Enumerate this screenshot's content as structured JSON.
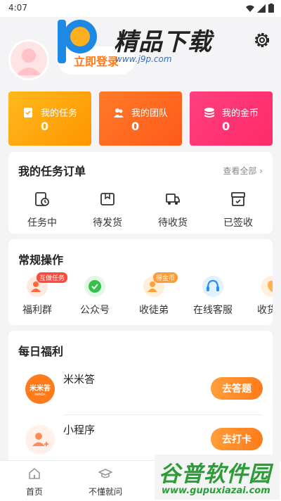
{
  "status_bar": {
    "time": "4:07"
  },
  "header": {
    "login_label": "立即登录",
    "watermark_title": "精品下载",
    "watermark_url": "www.j9p.com"
  },
  "stats": [
    {
      "label": "我的任务",
      "value": "0",
      "icon": "task-icon"
    },
    {
      "label": "我的团队",
      "value": "0",
      "icon": "team-icon"
    },
    {
      "label": "我的金币",
      "value": "0",
      "icon": "coin-icon"
    }
  ],
  "orders": {
    "title": "我的任务订单",
    "view_all": "查看全部 ›",
    "items": [
      {
        "label": "任务中",
        "icon": "clock-doc-icon"
      },
      {
        "label": "待发货",
        "icon": "package-icon"
      },
      {
        "label": "待收货",
        "icon": "truck-icon"
      },
      {
        "label": "已签收",
        "icon": "signed-box-icon"
      }
    ]
  },
  "operations": {
    "title": "常规操作",
    "items": [
      {
        "label": "福利群",
        "badge": "互做任务",
        "icon": "group-icon"
      },
      {
        "label": "公众号",
        "badge": "",
        "icon": "verified-icon"
      },
      {
        "label": "收徒弟",
        "badge": "得金币",
        "icon": "apprentice-icon"
      },
      {
        "label": "在线客服",
        "badge": "",
        "icon": "headset-icon"
      },
      {
        "label": "收货地",
        "badge": "",
        "icon": "address-icon"
      }
    ]
  },
  "welfare": {
    "title": "每日福利",
    "items": [
      {
        "name": "米米答",
        "button": "去答题",
        "logo_text": "米米答",
        "logo_sub": "MIMIDA"
      },
      {
        "name": "小程序",
        "button": "去打卡"
      }
    ]
  },
  "bottom_nav": [
    {
      "label": "首页",
      "icon": "home-icon"
    },
    {
      "label": "不懂就问",
      "icon": "graduation-cap-icon"
    }
  ],
  "watermark_bottom": {
    "title": "谷普软件园",
    "url": "www.gupuxiazai.com"
  },
  "colors": {
    "accent": "#ff7a1a",
    "task_card": "#ffaa10",
    "team_card": "#ff6a20",
    "gold_card": "#ff3573"
  }
}
